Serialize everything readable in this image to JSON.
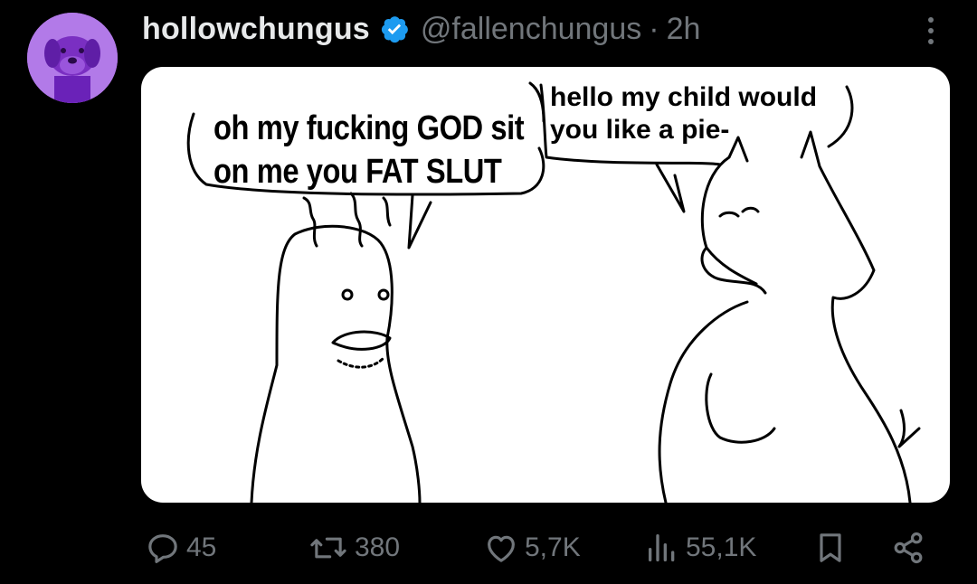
{
  "post": {
    "display_name": "hollowchungus",
    "handle": "@fallenchungus",
    "separator": "·",
    "time": "2h"
  },
  "media": {
    "bubble_left": "oh my fucking GOD sit\non me you FAT SLUT",
    "bubble_right": "hello my child would\nyou like a pie-"
  },
  "actions": {
    "replies": "45",
    "reposts": "380",
    "likes": "5,7K",
    "views": "55,1K"
  },
  "colors": {
    "background": "#000000",
    "primary_text": "#e7e9ea",
    "secondary_text": "#71767b",
    "verified_badge": "#1d9bf0",
    "avatar": "#a35fe0"
  },
  "icons": [
    "verified-badge-icon",
    "more-icon",
    "reply-icon",
    "repost-icon",
    "like-icon",
    "views-icon",
    "bookmark-icon",
    "share-icon"
  ]
}
